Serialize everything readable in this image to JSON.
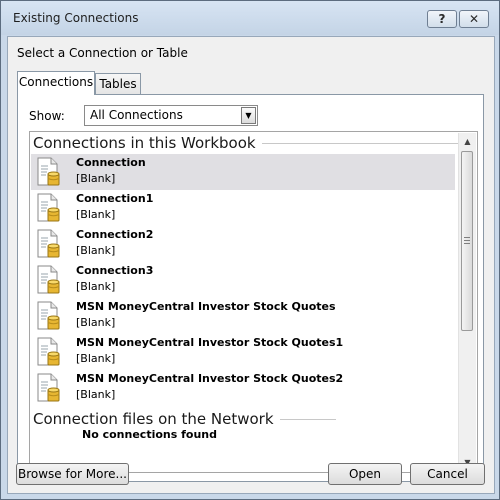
{
  "window": {
    "title": "Existing Connections",
    "help_label": "?",
    "close_label": "✕"
  },
  "prompt": "Select a Connection or Table",
  "tabs": [
    {
      "label": "Connections"
    },
    {
      "label": "Tables"
    }
  ],
  "show": {
    "label": "Show:",
    "selected": "All Connections"
  },
  "sections": [
    {
      "heading": "Connections in this Workbook",
      "items": [
        {
          "name": "Connection",
          "desc": "[Blank]",
          "selected": true
        },
        {
          "name": "Connection1",
          "desc": "[Blank]"
        },
        {
          "name": "Connection2",
          "desc": "[Blank]"
        },
        {
          "name": "Connection3",
          "desc": "[Blank]"
        },
        {
          "name": "MSN MoneyCentral Investor Stock Quotes",
          "desc": "[Blank]"
        },
        {
          "name": "MSN MoneyCentral Investor Stock Quotes1",
          "desc": "[Blank]"
        },
        {
          "name": "MSN MoneyCentral Investor Stock Quotes2",
          "desc": "[Blank]"
        }
      ]
    },
    {
      "heading": "Connection files on the Network",
      "partial_item": "No connections found"
    }
  ],
  "buttons": {
    "browse": "Browse for More...",
    "open": "Open",
    "cancel": "Cancel"
  },
  "colors": {
    "selection": "#e0dfe3",
    "frame": "#c9d8e9"
  }
}
